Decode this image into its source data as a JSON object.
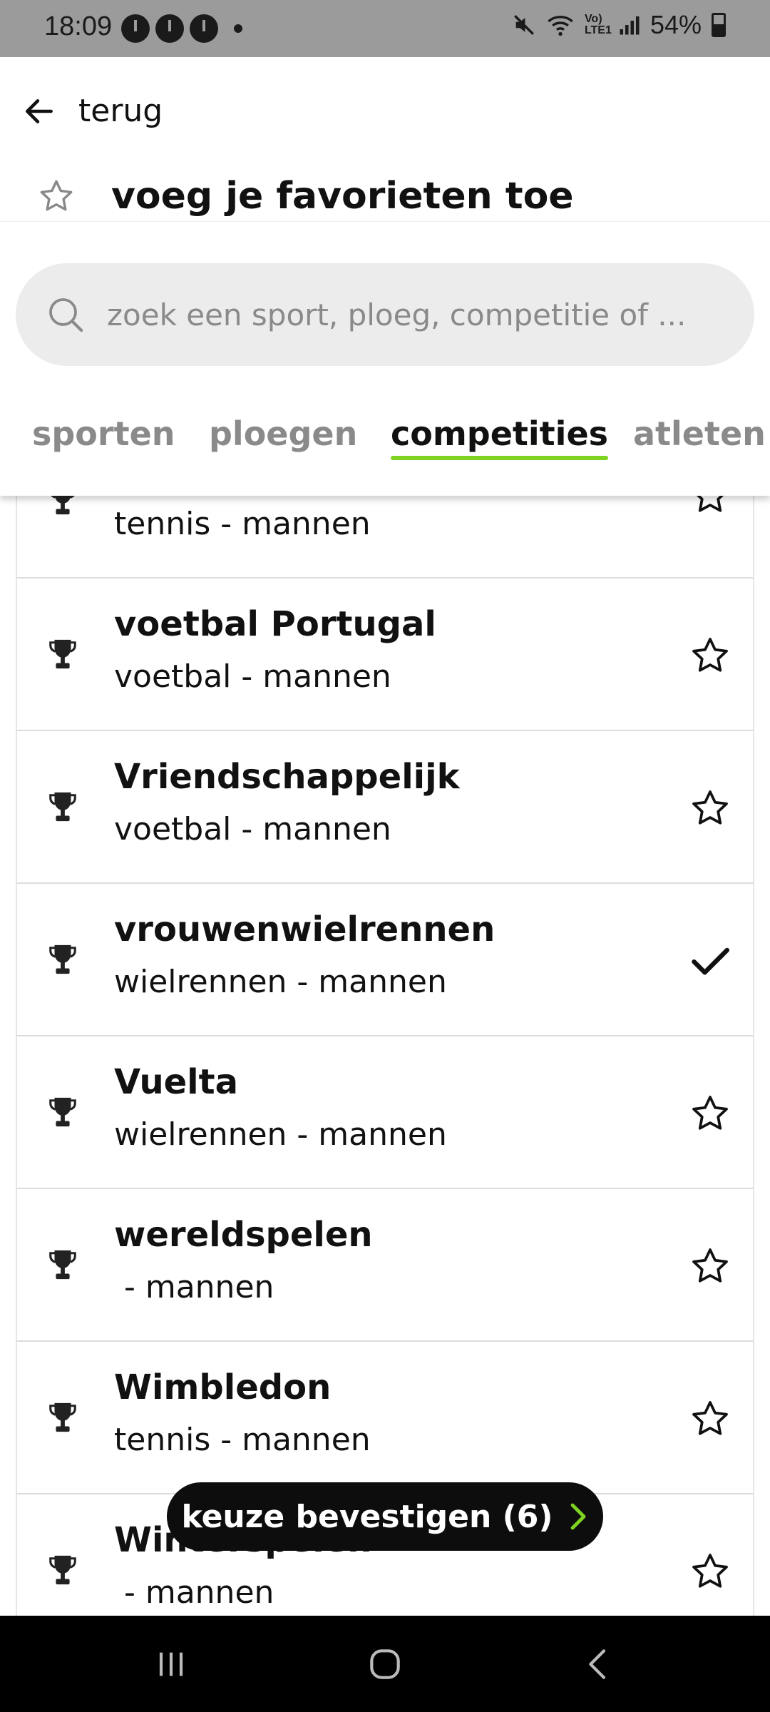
{
  "status_bar": {
    "time": "18:09",
    "battery": "54%",
    "network_label": "Vo) LTE1"
  },
  "header": {
    "back_label": "terug",
    "title": "voeg je favorieten toe"
  },
  "search": {
    "placeholder": "zoek een sport, ploeg, competitie of ..."
  },
  "tabs": [
    {
      "label": "sporten",
      "active": false
    },
    {
      "label": "ploegen",
      "active": false
    },
    {
      "label": "competities",
      "active": true
    },
    {
      "label": "atleten",
      "active": false
    }
  ],
  "list": [
    {
      "name": "",
      "sub": "tennis - mannen",
      "selected": false
    },
    {
      "name": "voetbal Portugal",
      "sub": "voetbal - mannen",
      "selected": false
    },
    {
      "name": "Vriendschappelijk",
      "sub": "voetbal - mannen",
      "selected": false
    },
    {
      "name": "vrouwenwielrennen",
      "sub": "wielrennen - mannen",
      "selected": true
    },
    {
      "name": "Vuelta",
      "sub": "wielrennen - mannen",
      "selected": false
    },
    {
      "name": "wereldspelen",
      "sub": " - mannen",
      "selected": false
    },
    {
      "name": "Wimbledon",
      "sub": "tennis - mannen",
      "selected": false
    },
    {
      "name": "Winterspelen",
      "sub": " - mannen",
      "selected": false
    }
  ],
  "confirm": {
    "label": "keuze bevestigen (6)"
  },
  "colors": {
    "accent": "#7ed321",
    "status_bar": "#9b9b9b",
    "button": "#0d0d0d"
  },
  "icons": {
    "back": "arrow-left-icon",
    "title": "star-outline-icon",
    "search": "search-icon",
    "list_item": "trophy-icon",
    "favorite": "star-outline-icon",
    "selected": "checkmark-icon",
    "confirm": "chevron-right-icon"
  }
}
